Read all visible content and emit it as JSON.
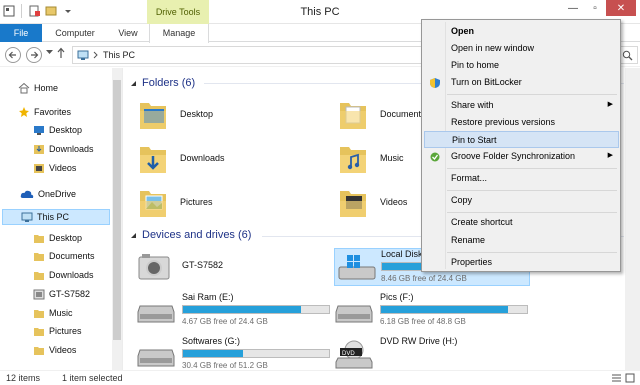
{
  "window": {
    "title": "This PC",
    "context_tab_header": "Drive Tools"
  },
  "ribbon": {
    "tabs": [
      "File",
      "Computer",
      "View",
      "Manage"
    ]
  },
  "address": {
    "path": "This PC"
  },
  "nav_pane": {
    "items": [
      {
        "label": "Home",
        "icon": "home-icon"
      },
      {
        "label": "Favorites",
        "icon": "star-icon"
      },
      {
        "label": "Desktop",
        "icon": "desktop-icon"
      },
      {
        "label": "Downloads",
        "icon": "downloads-icon"
      },
      {
        "label": "Videos",
        "icon": "videos-icon"
      },
      {
        "label": "OneDrive",
        "icon": "onedrive-icon"
      },
      {
        "label": "This PC",
        "icon": "computer-icon"
      },
      {
        "label": "Desktop",
        "icon": "folder-icon"
      },
      {
        "label": "Documents",
        "icon": "folder-icon"
      },
      {
        "label": "Downloads",
        "icon": "folder-icon"
      },
      {
        "label": "GT-S7582",
        "icon": "phone-icon"
      },
      {
        "label": "Music",
        "icon": "folder-icon"
      },
      {
        "label": "Pictures",
        "icon": "folder-icon"
      },
      {
        "label": "Videos",
        "icon": "folder-icon"
      }
    ]
  },
  "content": {
    "folders_header": "Folders (6)",
    "folders": [
      {
        "label": "Desktop"
      },
      {
        "label": "Documents"
      },
      {
        "label": "Downloads"
      },
      {
        "label": "Music"
      },
      {
        "label": "Pictures"
      },
      {
        "label": "Videos"
      }
    ],
    "devices_header": "Devices and drives (6)",
    "devices": [
      {
        "name": "GT-S7582",
        "kind": "phone"
      },
      {
        "name": "Local Disk",
        "free": "8.46 GB free of 24.4 GB",
        "fill": 0.65
      },
      {
        "name": "Sai Ram (E:)",
        "free": "4.67 GB free of 24.4 GB",
        "fill": 0.81
      },
      {
        "name": "Pics (F:)",
        "free": "6.18 GB free of 48.8 GB",
        "fill": 0.87
      },
      {
        "name": "Softwares (G:)",
        "free": "30.4 GB free of 51.2 GB",
        "fill": 0.41
      },
      {
        "name": "DVD RW Drive (H:)",
        "kind": "dvd"
      }
    ]
  },
  "status": {
    "items_count": "12 items",
    "selected": "1 item selected"
  },
  "context_menu": {
    "items": [
      {
        "label": "Open",
        "bold": true
      },
      {
        "label": "Open in new window"
      },
      {
        "label": "Pin to home"
      },
      {
        "label": "Turn on BitLocker",
        "icon": "shield-icon"
      },
      {
        "label": "Share with",
        "submenu": true
      },
      {
        "label": "Restore previous versions"
      },
      {
        "label": "Pin to Start",
        "highlighted": true
      },
      {
        "label": "Groove Folder Synchronization",
        "icon": "groove-icon",
        "submenu": true
      },
      {
        "label": "Format..."
      },
      {
        "label": "Copy"
      },
      {
        "label": "Create shortcut"
      },
      {
        "label": "Rename"
      },
      {
        "label": "Properties"
      }
    ]
  },
  "colors": {
    "accent": "#1979ca",
    "group_header": "#1e3287",
    "drive_bar": "#26a0da",
    "selection": "#cce8ff",
    "menu_highlight": "#d5e4f5"
  }
}
